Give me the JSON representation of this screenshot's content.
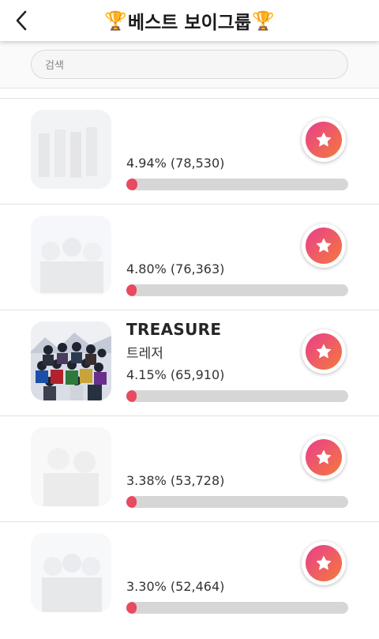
{
  "header": {
    "title": "베스트 보이그룹",
    "back_icon": "chevron-left-icon",
    "trophy_icon": "trophy-icon"
  },
  "search": {
    "placeholder": "검색",
    "value": ""
  },
  "colors": {
    "bar_fill": "#e84a5f",
    "bar_track": "#d6d6d6",
    "vote_gradient_start": "#e83e8c",
    "vote_gradient_end": "#f47a3c"
  },
  "items": [
    {
      "name": "",
      "sub": "",
      "stats": "4.94% (78,530)",
      "percent": 4.94,
      "votes": 78530,
      "vote_icon": "star-icon"
    },
    {
      "name": "",
      "sub": "",
      "stats": "4.80% (76,363)",
      "percent": 4.8,
      "votes": 76363,
      "vote_icon": "star-icon"
    },
    {
      "name": "TREASURE",
      "sub": "트레저",
      "stats": "4.15% (65,910)",
      "percent": 4.15,
      "votes": 65910,
      "vote_icon": "star-icon"
    },
    {
      "name": "",
      "sub": "",
      "stats": "3.38% (53,728)",
      "percent": 3.38,
      "votes": 53728,
      "vote_icon": "star-icon"
    },
    {
      "name": "",
      "sub": "",
      "stats": "3.30% (52,464)",
      "percent": 3.3,
      "votes": 52464,
      "vote_icon": "star-icon"
    }
  ]
}
